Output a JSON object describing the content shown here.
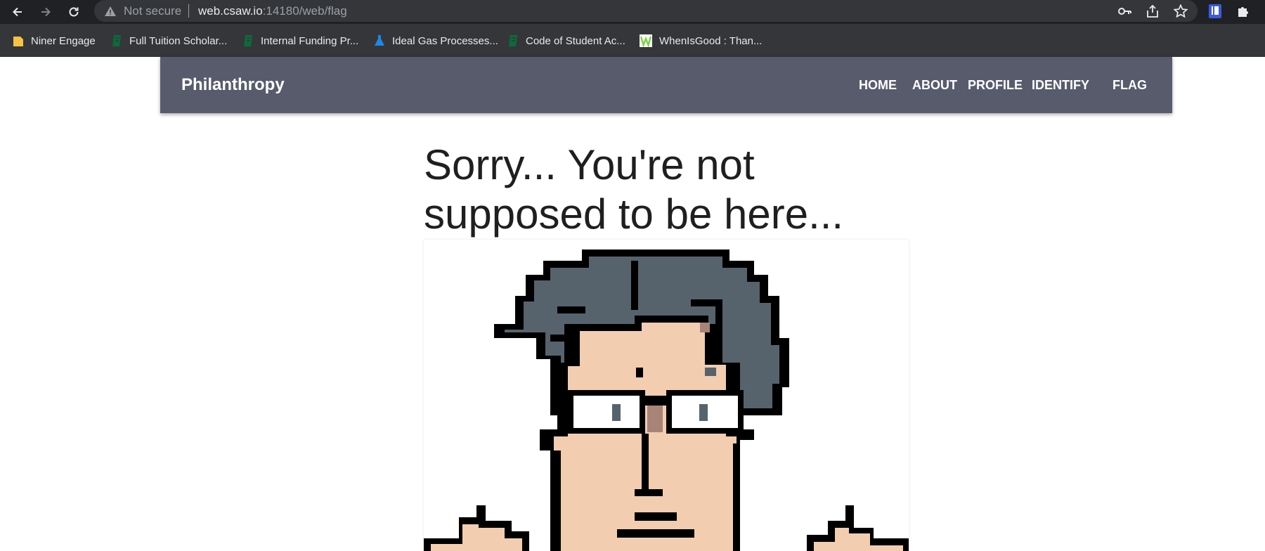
{
  "browser": {
    "security_label": "Not secure",
    "url_host": "web.csaw.io",
    "url_rest": ":14180/web/flag",
    "icons": [
      "back-arrow-icon",
      "forward-arrow-icon",
      "reload-icon",
      "warning-icon",
      "key-icon",
      "share-icon",
      "star-icon",
      "extension-book-icon",
      "puzzle-icon"
    ]
  },
  "bookmarks": [
    {
      "label": "Niner Engage",
      "icon": "folder-icon",
      "color": "#f6c343"
    },
    {
      "label": "Full Tuition Scholar...",
      "icon": "green-doc-icon",
      "color": "#0b6b3a"
    },
    {
      "label": "Internal Funding Pr...",
      "icon": "green-doc-icon",
      "color": "#0b6b3a"
    },
    {
      "label": "Ideal Gas Processes...",
      "icon": "flask-icon",
      "color": "#1e88e5"
    },
    {
      "label": "Code of Student Ac...",
      "icon": "green-doc-icon",
      "color": "#0b6b3a"
    },
    {
      "label": "WhenIsGood : Than...",
      "icon": "w-logo-icon",
      "color": "#7bd23c"
    }
  ],
  "site": {
    "brand": "Philanthropy",
    "nav": [
      "HOME",
      "ABOUT",
      "PROFILE",
      "IDENTIFY",
      "FLAG"
    ],
    "nav_bg": "#575b6c"
  },
  "main": {
    "heading_line1": "Sorry... You're not",
    "heading_line2": "supposed to be here..."
  },
  "portrait": {
    "icon": "pixel-art-nerd-portrait",
    "colors": {
      "hair": "#56636c",
      "skin": "#f2cdb0",
      "outline": "#000000",
      "shade": "#a88478"
    }
  }
}
